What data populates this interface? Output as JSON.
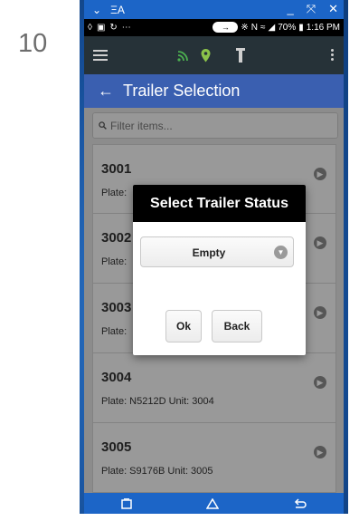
{
  "step_number": "10",
  "window": {
    "short_title": "ΞA",
    "minimize": "_",
    "restore": "⤧",
    "close": "✕"
  },
  "status_bar": {
    "left_icons": [
      "navigation-icon",
      "image-icon",
      "sync-icon",
      "more-icon"
    ],
    "battery_text": "70%",
    "time": "1:16 PM"
  },
  "toolbar": {
    "icons": [
      "rss-icon",
      "location-pin-icon",
      "trailer-icon",
      "menu-icon",
      "kebab-icon"
    ],
    "colors": {
      "rss": "#4caf50",
      "pin": "#8bc34a",
      "trailer": "#cfcfcf"
    }
  },
  "app_bar": {
    "back_icon": "arrow-left-icon",
    "title": "Trailer Selection"
  },
  "filter": {
    "placeholder": "Filter items..."
  },
  "trailers": [
    {
      "number": "3001",
      "detail": "Plate: "
    },
    {
      "number": "3002",
      "detail": "Plate: "
    },
    {
      "number": "3003",
      "detail": "Plate: "
    },
    {
      "number": "3004",
      "detail": "Plate: N5212D Unit: 3004"
    },
    {
      "number": "3005",
      "detail": "Plate: S9176B Unit: 3005"
    }
  ],
  "dialog": {
    "title": "Select Trailer Status",
    "selected_status": "Empty",
    "ok_label": "Ok",
    "back_label": "Back"
  },
  "colors": {
    "app_bar": "#3a5fb0",
    "toolbar": "#263238",
    "window_blue": "#1c65c7",
    "dialog_title": "#000000"
  }
}
